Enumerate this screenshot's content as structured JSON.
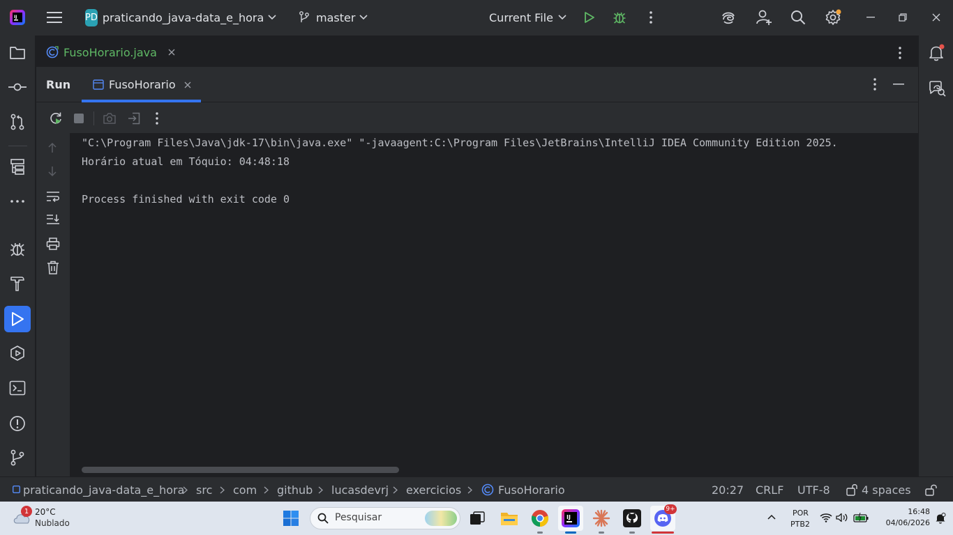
{
  "titlebar": {
    "project_badge": "PD",
    "project_name": "praticando_java-data_e_hora",
    "branch": "master",
    "run_config": "Current File",
    "icons": [
      "hamburger-menu-icon",
      "vcs-branch-icon",
      "run-icon",
      "debug-icon",
      "more-icon",
      "ai-assistant-icon",
      "add-user-icon",
      "search-icon",
      "settings-icon",
      "minimize-icon",
      "restore-icon",
      "close-icon"
    ]
  },
  "left_strip": {
    "icons": [
      "project-folder-icon",
      "commit-icon",
      "pull-requests-icon",
      "structure-icon",
      "more-tools-icon",
      "debug-icon",
      "build-icon",
      "run-icon",
      "services-icon",
      "terminal-icon",
      "problems-icon",
      "git-icon"
    ]
  },
  "editor": {
    "tab_label": "FusoHorario.java"
  },
  "run_panel": {
    "title": "Run",
    "tab_label": "FusoHorario"
  },
  "console": {
    "lines": [
      "\"C:\\Program Files\\Java\\jdk-17\\bin\\java.exe\" \"-javaagent:C:\\Program Files\\JetBrains\\IntelliJ IDEA Community Edition 2025.",
      "Horário atual em Tóquio: 04:48:18",
      "",
      "Process finished with exit code 0"
    ]
  },
  "statusbar": {
    "breadcrumbs": [
      "praticando_java-data_e_hora",
      "src",
      "com",
      "github",
      "lucasdevrj",
      "exercicios",
      "FusoHorario"
    ],
    "position": "20:27",
    "line_ending": "CRLF",
    "encoding": "UTF-8",
    "indent": "4 spaces"
  },
  "taskbar": {
    "weather_temp": "20°C",
    "weather_desc": "Nublado",
    "weather_badge": "1",
    "search_placeholder": "Pesquisar",
    "lang_top": "POR",
    "lang_bottom": "PTB2",
    "time": "16:48",
    "date": "04/06/2026",
    "discord_badge": "9+"
  },
  "colors": {
    "accent": "#3574f0",
    "run_green": "#5fb865",
    "badge_orange": "#f2a33a",
    "notification_red": "#e5534b"
  }
}
